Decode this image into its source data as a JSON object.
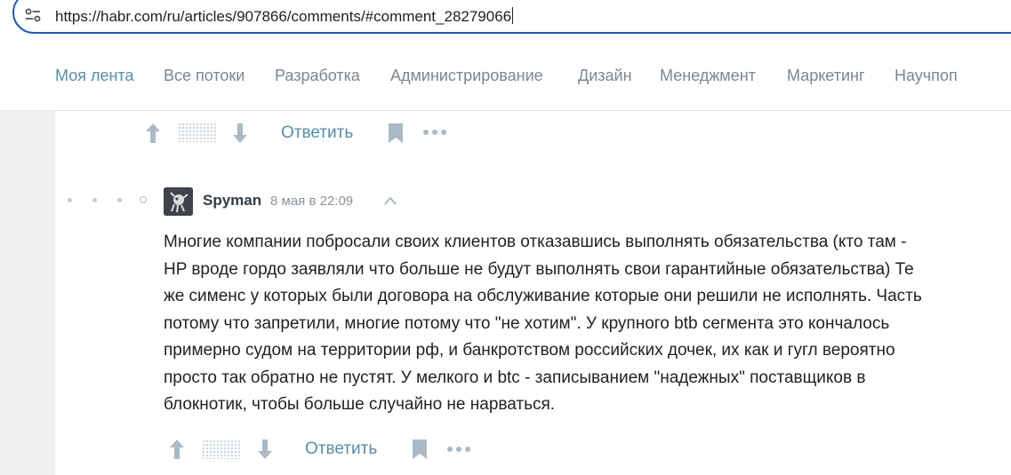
{
  "browser": {
    "url": "https://habr.com/ru/articles/907866/comments/#comment_28279066",
    "site_settings_icon": "tune-icon"
  },
  "nav": {
    "items": [
      {
        "label": "Моя лента",
        "active": true
      },
      {
        "label": "Все потоки",
        "active": false
      },
      {
        "label": "Разработка",
        "active": false
      },
      {
        "label": "Администрирование",
        "active": false
      },
      {
        "label": "Дизайн",
        "active": false
      },
      {
        "label": "Менеджмент",
        "active": false
      },
      {
        "label": "Маркетинг",
        "active": false
      },
      {
        "label": "Научпоп",
        "active": false
      }
    ]
  },
  "previous_comment": {
    "actions": {
      "reply_label": "Ответить"
    }
  },
  "comment": {
    "author": "Spyman",
    "timestamp": "8 мая в 22:09",
    "lines": [
      "Многие компании побросали своих клиентов отказавшись выполнять обязательства (кто там -",
      "HP вроде гордо заявляли что больше не будут выполнять свои гарантийные обязательства) Те",
      "же сименс у которых были договора на обслуживание которые они решили не исполнять. Часть",
      "потому что запретили, многие потому что \"не хотим\". У крупного btb сегмента это кончалось",
      "примерно судом на территории рф, и банкротством российских дочек, их как и гугл вероятно",
      "просто так обратно не пустят. У мелкого и btc - записыванием \"надежных\" поставщиков в",
      "блокнотик, чтобы больше случайно не нарваться."
    ],
    "actions": {
      "reply_label": "Ответить"
    }
  },
  "colors": {
    "accent": "#548eaa",
    "nav_text": "#7b8791",
    "icon": "#a9bac6",
    "address_border": "#1f5bb8"
  }
}
